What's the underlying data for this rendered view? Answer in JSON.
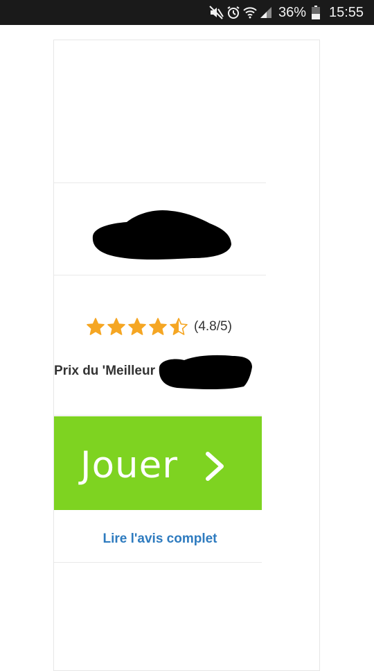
{
  "status_bar": {
    "battery": "36%",
    "time": "15:55",
    "icons": [
      "mute-icon",
      "alarm-icon",
      "wifi-icon",
      "signal-icon",
      "battery-icon"
    ]
  },
  "offer": {
    "rating": {
      "stars": 4.5,
      "max_stars": 5,
      "text": "(4.8/5)",
      "star_color": "#f5a623"
    },
    "award_text": "Prix du 'Meilleur",
    "play_button": {
      "label": "Jouer",
      "background": "#7ed321"
    },
    "review_link": "Lire l'avis complet",
    "link_color": "#2e7bbf"
  }
}
